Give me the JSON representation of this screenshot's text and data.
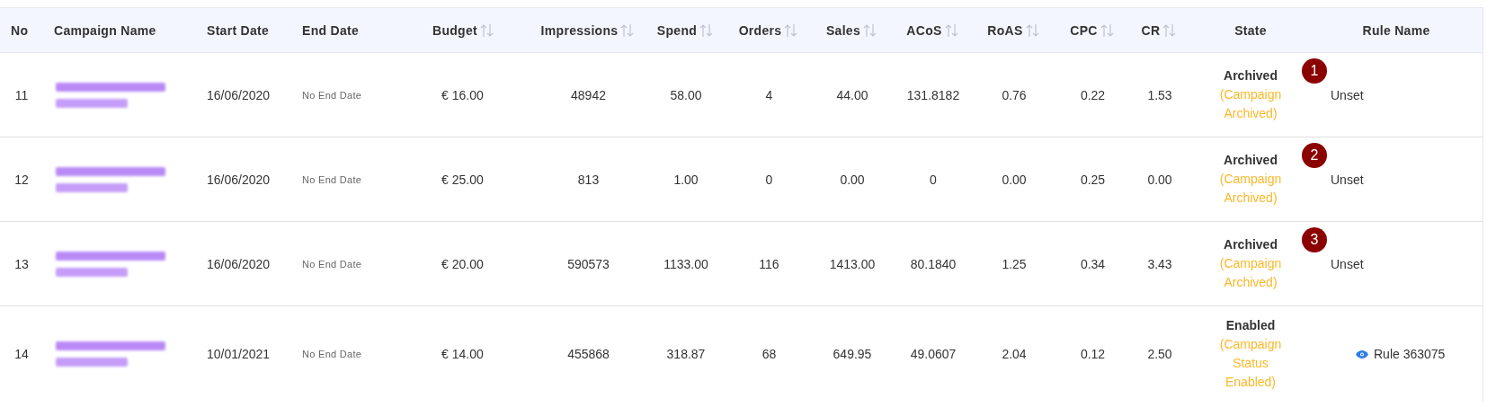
{
  "table": {
    "columns": [
      {
        "label": "No",
        "sortable": false
      },
      {
        "label": "Campaign Name",
        "sortable": false
      },
      {
        "label": "Start Date",
        "sortable": false
      },
      {
        "label": "End Date",
        "sortable": false
      },
      {
        "label": "Budget",
        "sortable": true
      },
      {
        "label": "Impressions",
        "sortable": true
      },
      {
        "label": "Spend",
        "sortable": true
      },
      {
        "label": "Orders",
        "sortable": true
      },
      {
        "label": "Sales",
        "sortable": true
      },
      {
        "label": "ACoS",
        "sortable": true
      },
      {
        "label": "RoAS",
        "sortable": true
      },
      {
        "label": "CPC",
        "sortable": true
      },
      {
        "label": "CR",
        "sortable": true
      },
      {
        "label": "State",
        "sortable": false
      },
      {
        "label": "Rule Name",
        "sortable": false
      }
    ],
    "rows": [
      {
        "no": "11",
        "start": "16/06/2020",
        "end": "No End Date",
        "budget": "€ 16.00",
        "impressions": "48942",
        "spend": "58.00",
        "orders": "4",
        "sales": "44.00",
        "acos": "131.8182",
        "roas": "0.76",
        "cpc": "0.22",
        "cr": "1.53",
        "state": "Archived",
        "state_note": "(Campaign Archived)",
        "rule": {
          "kind": "plain",
          "text": "Unset"
        },
        "badge": "1"
      },
      {
        "no": "12",
        "start": "16/06/2020",
        "end": "No End Date",
        "budget": "€ 25.00",
        "impressions": "813",
        "spend": "1.00",
        "orders": "0",
        "sales": "0.00",
        "acos": "0",
        "roas": "0.00",
        "cpc": "0.25",
        "cr": "0.00",
        "state": "Archived",
        "state_note": "(Campaign Archived)",
        "rule": {
          "kind": "plain",
          "text": "Unset"
        },
        "badge": "2"
      },
      {
        "no": "13",
        "start": "16/06/2020",
        "end": "No End Date",
        "budget": "€ 20.00",
        "impressions": "590573",
        "spend": "1133.00",
        "orders": "116",
        "sales": "1413.00",
        "acos": "80.1840",
        "roas": "1.25",
        "cpc": "0.34",
        "cr": "3.43",
        "state": "Archived",
        "state_note": "(Campaign Archived)",
        "rule": {
          "kind": "plain",
          "text": "Unset"
        },
        "badge": "3"
      },
      {
        "no": "14",
        "start": "10/01/2021",
        "end": "No End Date",
        "budget": "€ 14.00",
        "impressions": "455868",
        "spend": "318.87",
        "orders": "68",
        "sales": "649.95",
        "acos": "49.0607",
        "roas": "2.04",
        "cpc": "0.12",
        "cr": "2.50",
        "state": "Enabled",
        "state_note": "(Campaign Status Enabled)",
        "rule": {
          "kind": "link",
          "text": "Rule 363075"
        }
      }
    ]
  }
}
